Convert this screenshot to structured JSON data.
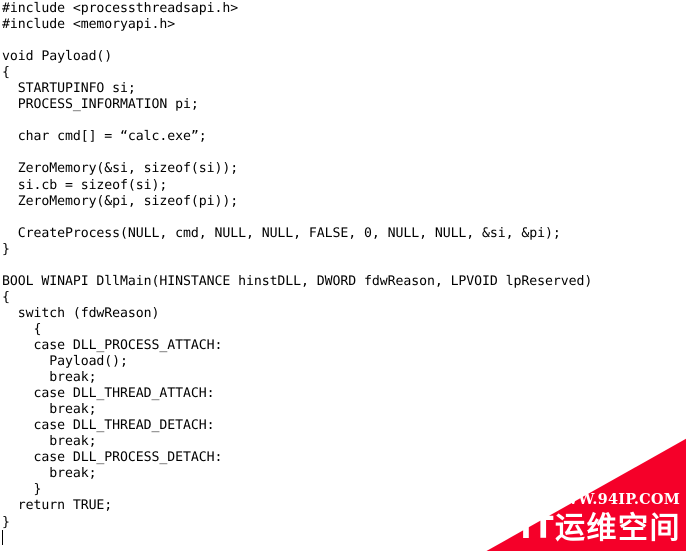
{
  "editor": {
    "language": "c",
    "text_color": "#000000",
    "background_color": "#ffffff",
    "caret_visible": true,
    "code": "#include <processthreadsapi.h>\n#include <memoryapi.h>\n\nvoid Payload()\n{\n  STARTUPINFO si;\n  PROCESS_INFORMATION pi;\n\n  char cmd[] = “calc.exe”;\n\n  ZeroMemory(&si, sizeof(si));\n  si.cb = sizeof(si);\n  ZeroMemory(&pi, sizeof(pi));\n\n  CreateProcess(NULL, cmd, NULL, NULL, FALSE, 0, NULL, NULL, &si, &pi);\n}\n\nBOOL WINAPI DllMain(HINSTANCE hinstDLL, DWORD fdwReason, LPVOID lpReserved)\n{\n  switch (fdwReason)\n    {\n    case DLL_PROCESS_ATTACH:\n      Payload();\n      break;\n    case DLL_THREAD_ATTACH:\n      break;\n    case DLL_THREAD_DETACH:\n      break;\n    case DLL_PROCESS_DETACH:\n      break;\n    }\n  return TRUE;\n}",
    "lines": [
      "#include <processthreadsapi.h>",
      "#include <memoryapi.h>",
      "",
      "void Payload()",
      "{",
      "  STARTUPINFO si;",
      "  PROCESS_INFORMATION pi;",
      "",
      "  char cmd[] = “calc.exe”;",
      "",
      "  ZeroMemory(&si, sizeof(si));",
      "  si.cb = sizeof(si);",
      "  ZeroMemory(&pi, sizeof(pi));",
      "",
      "  CreateProcess(NULL, cmd, NULL, NULL, FALSE, 0, NULL, NULL, &si, &pi);",
      "}",
      "",
      "BOOL WINAPI DllMain(HINSTANCE hinstDLL, DWORD fdwReason, LPVOID lpReserved)",
      "{",
      "  switch (fdwReason)",
      "    {",
      "    case DLL_PROCESS_ATTACH:",
      "      Payload();",
      "      break;",
      "    case DLL_THREAD_ATTACH:",
      "      break;",
      "    case DLL_THREAD_DETACH:",
      "      break;",
      "    case DLL_PROCESS_DETACH:",
      "      break;",
      "    }",
      "  return TRUE;",
      "}",
      ""
    ]
  },
  "watermark": {
    "url_text": "WWW.94IP.COM",
    "brand_text": "IT运维空间",
    "red_color": "#f50029",
    "text_color": "#ffffff"
  }
}
